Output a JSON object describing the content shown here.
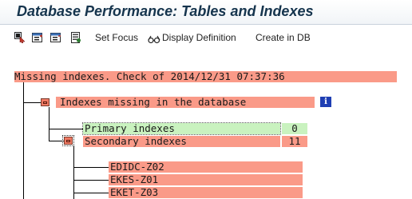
{
  "window": {
    "title": "Database Performance: Tables and Indexes"
  },
  "toolbar": {
    "icons": [
      "select-icon",
      "expand-all-icon",
      "collapse-all-icon",
      "detail-icon"
    ],
    "set_focus": "Set Focus",
    "display_definition": "Display Definition",
    "create_in_db": "Create in DB"
  },
  "tree": {
    "root": "Missing indexes. Check of 2014/12/31 07:37:36",
    "group": "Indexes missing in the database",
    "primary": {
      "label": "Primary indexes",
      "count": "0"
    },
    "secondary": {
      "label": "Secondary indexes",
      "count": "11"
    },
    "items": [
      "EDIDC-Z02",
      "EKES-Z01",
      "EKET-Z03"
    ]
  },
  "colors": {
    "error": "#fa9a88",
    "ok": "#c9f2bf",
    "info": "#1f3fb3"
  }
}
